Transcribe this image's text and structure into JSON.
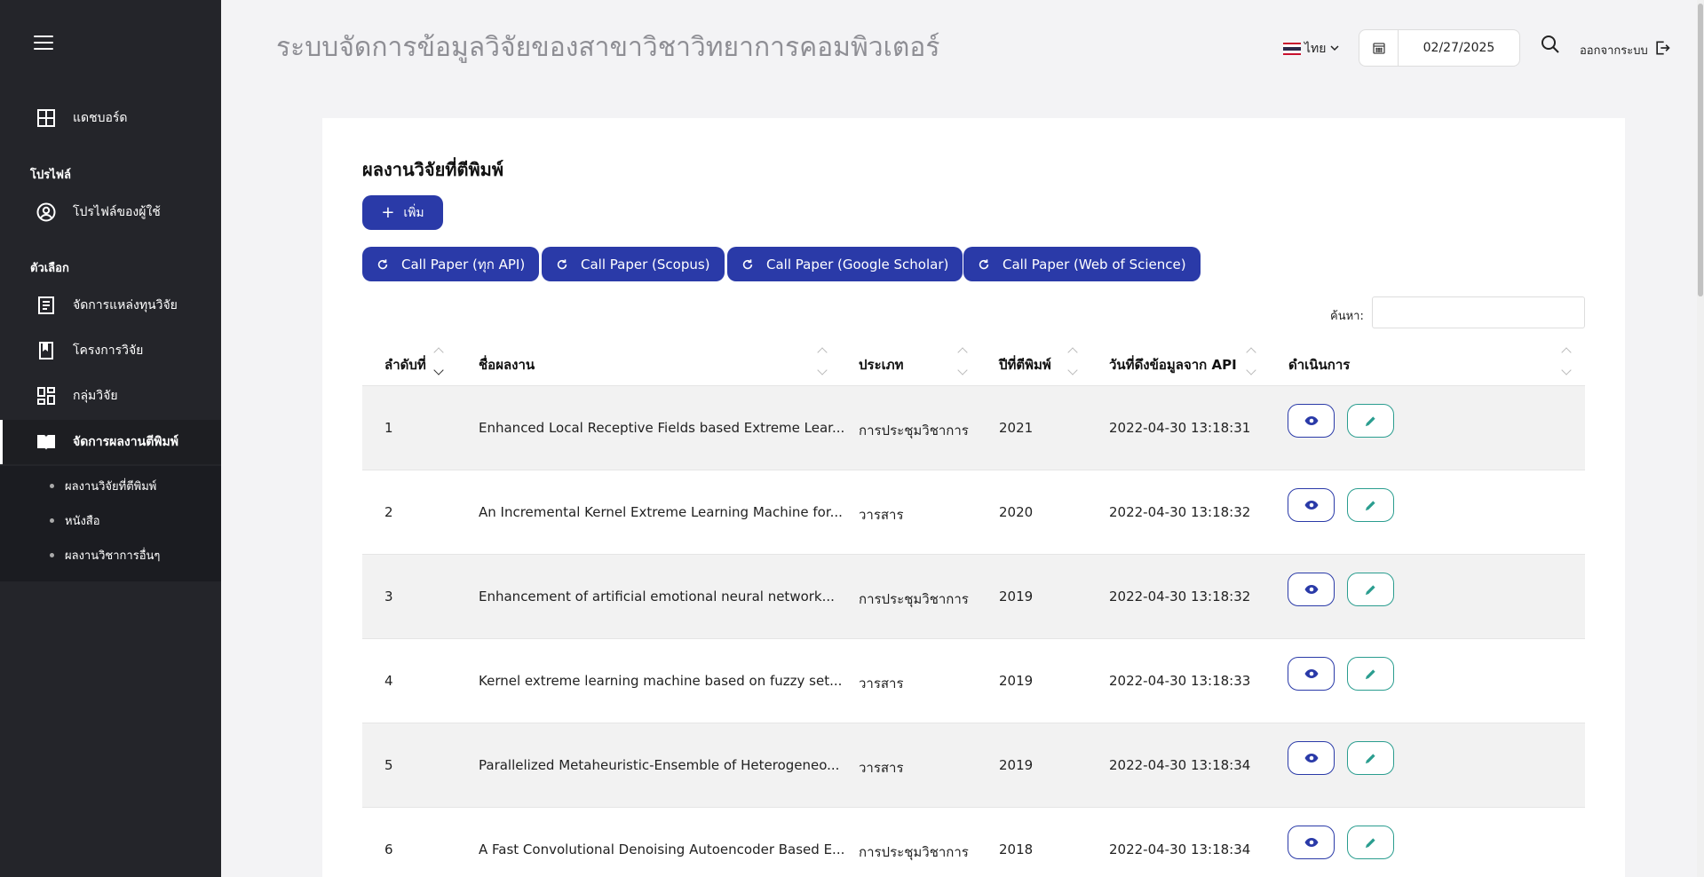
{
  "sidebar": {
    "dashboard": "แดชบอร์ด",
    "section_profile": "โปรไฟล์",
    "user_profile": "โปรไฟล์ของผู้ใช้",
    "section_options": "ตัวเลือก",
    "manage_funding": "จัดการแหล่งทุนวิจัย",
    "research_projects": "โครงการวิจัย",
    "research_groups": "กลุ่มวิจัย",
    "manage_publications": "จัดการผลงานตีพิมพ์",
    "sub_items": [
      "ผลงานวิจัยที่ตีพิมพ์",
      "หนังสือ",
      "ผลงานวิชาการอื่นๆ"
    ]
  },
  "header": {
    "title": "ระบบจัดการข้อมูลวิจัยของสาขาวิชาวิทยาการคอมพิวเตอร์",
    "language": "ไทย",
    "date": "02/27/2025",
    "logout": "ออกจากระบบ"
  },
  "card": {
    "title": "ผลงานวิจัยที่ตีพิมพ์",
    "add_label": "เพิ่ม",
    "call_buttons": [
      "Call Paper (ทุก API)",
      "Call Paper (Scopus)",
      "Call Paper (Google Scholar)",
      "Call Paper (Web of Science)"
    ],
    "search_label": "ค้นหา:",
    "search_value": ""
  },
  "table": {
    "headers": [
      "ลำดับที่",
      "ชื่อผลงาน",
      "ประเภท",
      "ปีที่ตีพิมพ์",
      "วันที่ดึงข้อมูลจาก API",
      "ดำเนินการ"
    ],
    "rows": [
      [
        "1",
        "Enhanced Local Receptive Fields based Extreme Lear...",
        "การประชุมวิชาการ",
        "2021",
        "2022-04-30 13:18:31"
      ],
      [
        "2",
        "An Incremental Kernel Extreme Learning Machine for...",
        "วารสาร",
        "2020",
        "2022-04-30 13:18:32"
      ],
      [
        "3",
        "Enhancement of artificial emotional neural network...",
        "การประชุมวิชาการ",
        "2019",
        "2022-04-30 13:18:32"
      ],
      [
        "4",
        "Kernel extreme learning machine based on fuzzy set...",
        "วารสาร",
        "2019",
        "2022-04-30 13:18:33"
      ],
      [
        "5",
        "Parallelized Metaheuristic-Ensemble of Heterogeneo...",
        "วารสาร",
        "2019",
        "2022-04-30 13:18:34"
      ],
      [
        "6",
        "A Fast Convolutional Denoising Autoencoder Based E...",
        "การประชุมวิชาการ",
        "2018",
        "2022-04-30 13:18:34"
      ]
    ]
  },
  "colors": {
    "sidebar_bg": "#24252a",
    "primary": "#2a3aa8",
    "edit_accent": "#2a9d8f"
  },
  "icons": [
    "menu-icon",
    "dashboard-icon",
    "user-circle-icon",
    "document-icon",
    "bookmark-icon",
    "grid-icon",
    "book-open-icon",
    "calendar-icon",
    "search-icon",
    "logout-icon",
    "refresh-icon",
    "eye-icon",
    "pencil-icon"
  ]
}
